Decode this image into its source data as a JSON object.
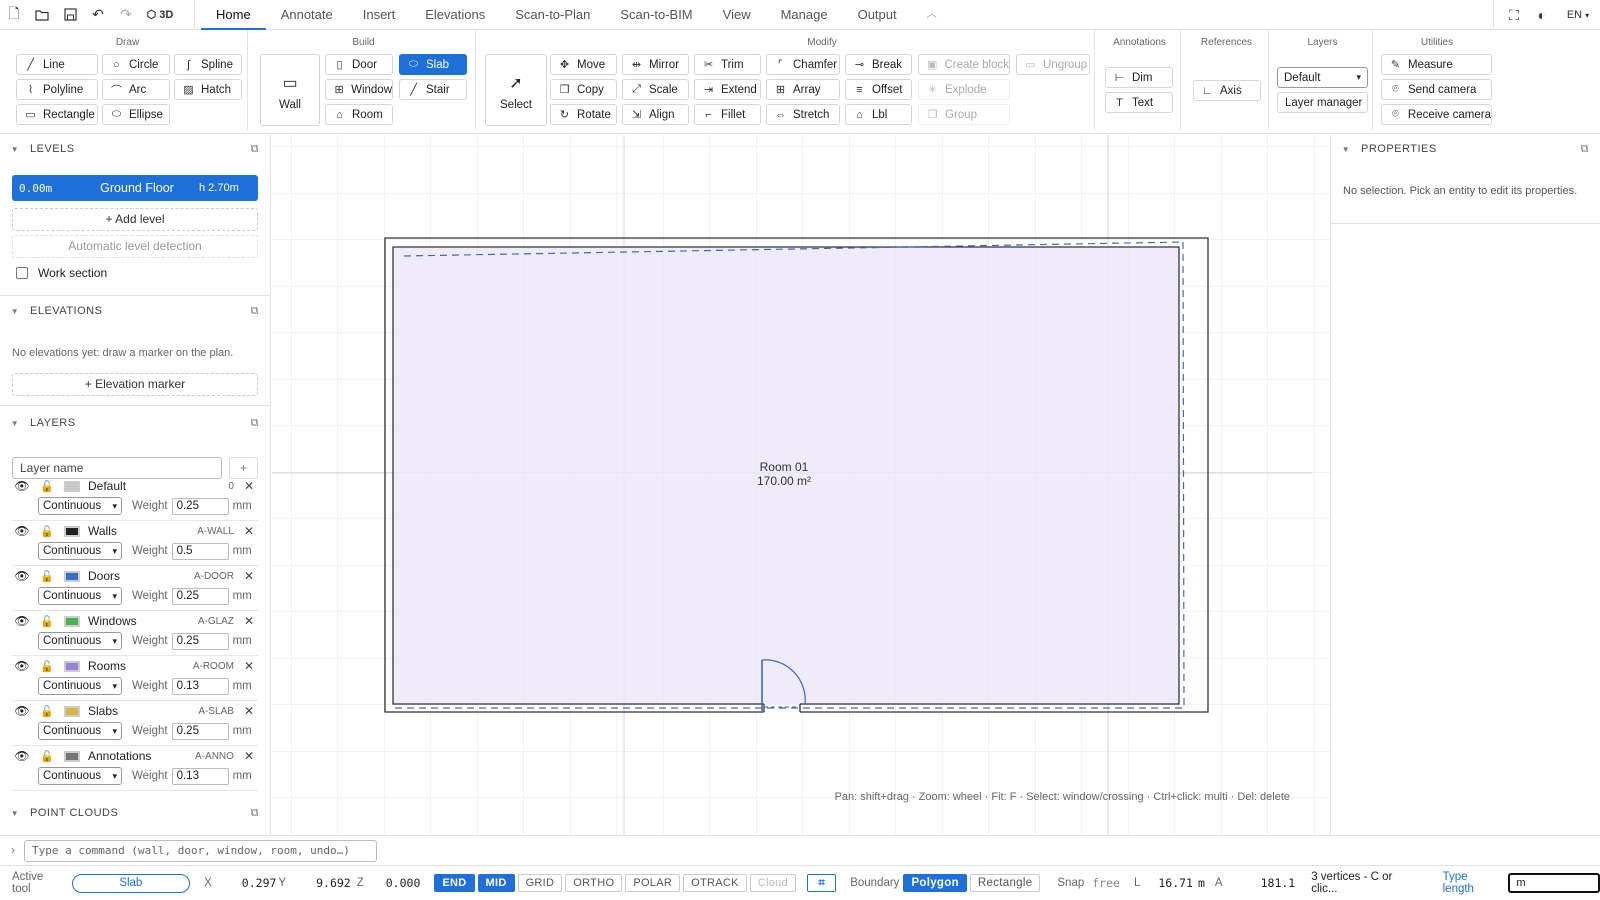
{
  "topbar": {
    "icons": [
      "new-file-icon",
      "open-folder-icon",
      "save-icon",
      "undo-icon",
      "redo-icon",
      "cube-icon"
    ],
    "mode_3d": "3D",
    "tabs": [
      "Home",
      "Annotate",
      "Insert",
      "Elevations",
      "Scan-to-Plan",
      "Scan-to-BIM",
      "View",
      "Manage",
      "Output"
    ],
    "active_tab": "Home",
    "lang": "EN"
  },
  "ribbon": {
    "draw": {
      "title": "Draw",
      "line": "Line",
      "circle": "Circle",
      "spline": "Spline",
      "polyline": "Polyline",
      "arc": "Arc",
      "hatch": "Hatch",
      "rectangle": "Rectangle",
      "ellipse": "Ellipse"
    },
    "build": {
      "title": "Build",
      "wall": "Wall",
      "door": "Door",
      "slab": "Slab",
      "window": "Window",
      "stair": "Stair",
      "room": "Room"
    },
    "select": "Select",
    "modify": {
      "title": "Modify",
      "move": "Move",
      "mirror": "Mirror",
      "trim": "Trim",
      "chamfer": "Chamfer",
      "break": "Break",
      "create_block": "Create block",
      "ungroup": "Ungroup",
      "copy": "Copy",
      "scale": "Scale",
      "extend": "Extend",
      "array": "Array",
      "offset": "Offset",
      "explode": "Explode",
      "rotate": "Rotate",
      "align": "Align",
      "fillet": "Fillet",
      "stretch": "Stretch",
      "lbl": "Lbl",
      "group": "Group"
    },
    "annotations": {
      "title": "Annotations",
      "dim": "Dim",
      "text": "Text"
    },
    "references": {
      "title": "References",
      "axis": "Axis"
    },
    "layers": {
      "title": "Layers",
      "current": "Default",
      "manager": "Layer manager"
    },
    "utilities": {
      "title": "Utilities",
      "measure": "Measure",
      "send_camera": "Send camera",
      "receive_camera": "Receive camera"
    }
  },
  "left": {
    "levels": {
      "title": "LEVELS",
      "level_elev": "0.00m",
      "level_name": "Ground Floor",
      "level_height": "h 2.70m",
      "add": "+ Add level",
      "auto": "Automatic level detection",
      "work_section": "Work section"
    },
    "elevations": {
      "title": "ELEVATIONS",
      "empty": "No elevations yet: draw a marker on the plan.",
      "add": "+ Elevation marker"
    },
    "layers": {
      "title": "LAYERS",
      "placeholder": "Layer name",
      "add": "+",
      "weight_label": "Weight",
      "unit": "mm",
      "items": [
        {
          "name": "Default",
          "code": "0",
          "line": "Continuous",
          "weight": "0.25",
          "color": "#c8c8c8"
        },
        {
          "name": "Walls",
          "code": "A-WALL",
          "line": "Continuous",
          "weight": "0.5",
          "color": "#222222"
        },
        {
          "name": "Doors",
          "code": "A-DOOR",
          "line": "Continuous",
          "weight": "0.25",
          "color": "#3a6fc4"
        },
        {
          "name": "Windows",
          "code": "A-GLAZ",
          "line": "Continuous",
          "weight": "0.25",
          "color": "#4caf50"
        },
        {
          "name": "Rooms",
          "code": "A-ROOM",
          "line": "Continuous",
          "weight": "0.13",
          "color": "#9c7fd6"
        },
        {
          "name": "Slabs",
          "code": "A-SLAB",
          "line": "Continuous",
          "weight": "0.25",
          "color": "#d9b44a"
        },
        {
          "name": "Annotations",
          "code": "A-ANNO",
          "line": "Continuous",
          "weight": "0.13",
          "color": "#777777"
        }
      ]
    },
    "point_clouds": {
      "title": "POINT CLOUDS"
    }
  },
  "canvas": {
    "room_name": "Room 01",
    "room_area": "170.00 m²",
    "hint": "Pan: shift+drag · Zoom: wheel · Fit: F · Select: window/crossing · Ctrl+click: multi · Del: delete"
  },
  "properties": {
    "title": "PROPERTIES",
    "empty": "No selection. Pick an entity to edit its properties."
  },
  "command": {
    "prompt": "›",
    "placeholder": "Type a command (wall, door, window, room, undo…)"
  },
  "status": {
    "active_tool_label": "Active tool",
    "active_tool": "Slab",
    "x_label": "X",
    "x": "0.297",
    "y_label": "Y",
    "y": "9.692",
    "z_label": "Z",
    "z": "0.000",
    "toggles": [
      {
        "label": "END",
        "on": true
      },
      {
        "label": "MID",
        "on": true
      },
      {
        "label": "GRID",
        "on": false
      },
      {
        "label": "ORTHO",
        "on": false
      },
      {
        "label": "POLAR",
        "on": false
      },
      {
        "label": "OTRACK",
        "on": false
      },
      {
        "label": "Cloud",
        "on": false,
        "disabled": true
      }
    ],
    "boundary_label": "Boundary",
    "polygon": "Polygon",
    "rectangle": "Rectangle",
    "snap_label": "Snap",
    "snap": "free",
    "l_label": "L",
    "l_val": "16.71",
    "l_unit": "m",
    "a_label": "A",
    "a_val": "181.1",
    "vertices": "3 vertices - C or clic...",
    "type_length_label": "Type length",
    "type_length_value": "m"
  }
}
